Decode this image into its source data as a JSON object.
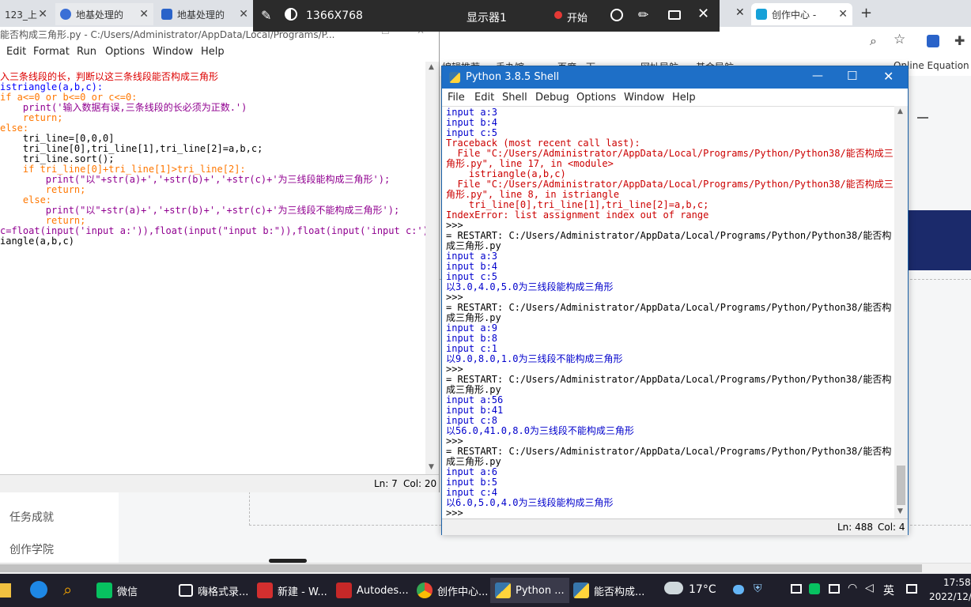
{
  "browser": {
    "tabs": [
      {
        "label": "123_上"
      },
      {
        "label": "地基处理的"
      },
      {
        "label": "地基处理的"
      },
      {
        "label": "创作中心 -"
      }
    ],
    "bookmarks": [
      "编辑推荐",
      "手办馆",
      "百度一下",
      "网址导航",
      "基金导航",
      "Online Equation E"
    ],
    "left_nav": [
      "任务成就",
      "创作学院"
    ]
  },
  "recorder": {
    "resolution": "1366X768",
    "monitor": "显示器1",
    "start_label": "开始"
  },
  "editor": {
    "title": "能否构成三角形.py - C:/Users/Administrator/AppData/Local/Programs/P...",
    "menu": [
      "Edit",
      "Format",
      "Run",
      "Options",
      "Window",
      "Help"
    ],
    "status_ln": "Ln: 7",
    "status_col": "Col: 20",
    "code": [
      "入三条线段的长，判断以这三条线段能否构成三角形",
      "istriangle(a,b,c):",
      "if a<=0 or b<=0 or c<=0:",
      "    print('输入数据有误,三条线段的长必须为正数.')",
      "    return;",
      "else:",
      "    tri_line=[0,0,0]",
      "    tri_line[0],tri_line[1],tri_line[2]=a,b,c;",
      "    tri_line.sort();",
      "    if tri_line[0]+tri_line[1]>tri_line[2]:",
      "        print(\"以\"+str(a)+','+str(b)+','+str(c)+'为三线段能构成三角形');",
      "        return;",
      "    else:",
      "        print(\"以\"+str(a)+','+str(b)+','+str(c)+'为三线段不能构成三角形');",
      "        return;",
      "c=float(input('input a:')),float(input(\"input b:\")),float(input('input c:'))",
      "iangle(a,b,c)"
    ]
  },
  "shell": {
    "title": "Python 3.8.5 Shell",
    "menu": [
      "File",
      "Edit",
      "Shell",
      "Debug",
      "Options",
      "Window",
      "Help"
    ],
    "status_ln": "Ln: 488",
    "status_col": "Col: 4",
    "lines": [
      {
        "t": "input a:3",
        "k": "so"
      },
      {
        "t": "input b:4",
        "k": "so"
      },
      {
        "t": "input c:5",
        "k": "so"
      },
      {
        "t": "Traceback (most recent call last):",
        "k": "se"
      },
      {
        "t": "  File \"C:/Users/Administrator/AppData/Local/Programs/Python/Python38/能否构成三",
        "k": "se"
      },
      {
        "t": "角形.py\", line 17, in <module>",
        "k": "se"
      },
      {
        "t": "    istriangle(a,b,c)",
        "k": "se"
      },
      {
        "t": "  File \"C:/Users/Administrator/AppData/Local/Programs/Python/Python38/能否构成三",
        "k": "se"
      },
      {
        "t": "角形.py\", line 8, in istriangle",
        "k": "se"
      },
      {
        "t": "    tri_line[0],tri_line[1],tri_line[2]=a,b,c;",
        "k": "se"
      },
      {
        "t": "IndexError: list assignment index out of range",
        "k": "se"
      },
      {
        "t": ">>>",
        "k": "sn"
      },
      {
        "t": "= RESTART: C:/Users/Administrator/AppData/Local/Programs/Python/Python38/能否构",
        "k": "sn"
      },
      {
        "t": "成三角形.py",
        "k": "sn"
      },
      {
        "t": "input a:3",
        "k": "so"
      },
      {
        "t": "input b:4",
        "k": "so"
      },
      {
        "t": "input c:5",
        "k": "so"
      },
      {
        "t": "以3.0,4.0,5.0为三线段能构成三角形",
        "k": "so"
      },
      {
        "t": ">>>",
        "k": "sn"
      },
      {
        "t": "= RESTART: C:/Users/Administrator/AppData/Local/Programs/Python/Python38/能否构",
        "k": "sn"
      },
      {
        "t": "成三角形.py",
        "k": "sn"
      },
      {
        "t": "input a:9",
        "k": "so"
      },
      {
        "t": "input b:8",
        "k": "so"
      },
      {
        "t": "input c:1",
        "k": "so"
      },
      {
        "t": "以9.0,8.0,1.0为三线段不能构成三角形",
        "k": "so"
      },
      {
        "t": ">>>",
        "k": "sn"
      },
      {
        "t": "= RESTART: C:/Users/Administrator/AppData/Local/Programs/Python/Python38/能否构",
        "k": "sn"
      },
      {
        "t": "成三角形.py",
        "k": "sn"
      },
      {
        "t": "input a:56",
        "k": "so"
      },
      {
        "t": "input b:41",
        "k": "so"
      },
      {
        "t": "input c:8",
        "k": "so"
      },
      {
        "t": "以56.0,41.0,8.0为三线段不能构成三角形",
        "k": "so"
      },
      {
        "t": ">>>",
        "k": "sn"
      },
      {
        "t": "= RESTART: C:/Users/Administrator/AppData/Local/Programs/Python/Python38/能否构",
        "k": "sn"
      },
      {
        "t": "成三角形.py",
        "k": "sn"
      },
      {
        "t": "input a:6",
        "k": "so"
      },
      {
        "t": "input b:5",
        "k": "so"
      },
      {
        "t": "input c:4",
        "k": "so"
      },
      {
        "t": "以6.0,5.0,4.0为三线段能构成三角形",
        "k": "so"
      },
      {
        "t": ">>> ",
        "k": "sn"
      }
    ]
  },
  "taskbar": {
    "items": [
      "微信",
      "嗨格式录...",
      "新建 - W...",
      "Autodes...",
      "创作中心...",
      "Python ...",
      "能否构成..."
    ],
    "weather": "17°C",
    "ime": "英",
    "time": "17:58",
    "date": "2022/12/"
  }
}
